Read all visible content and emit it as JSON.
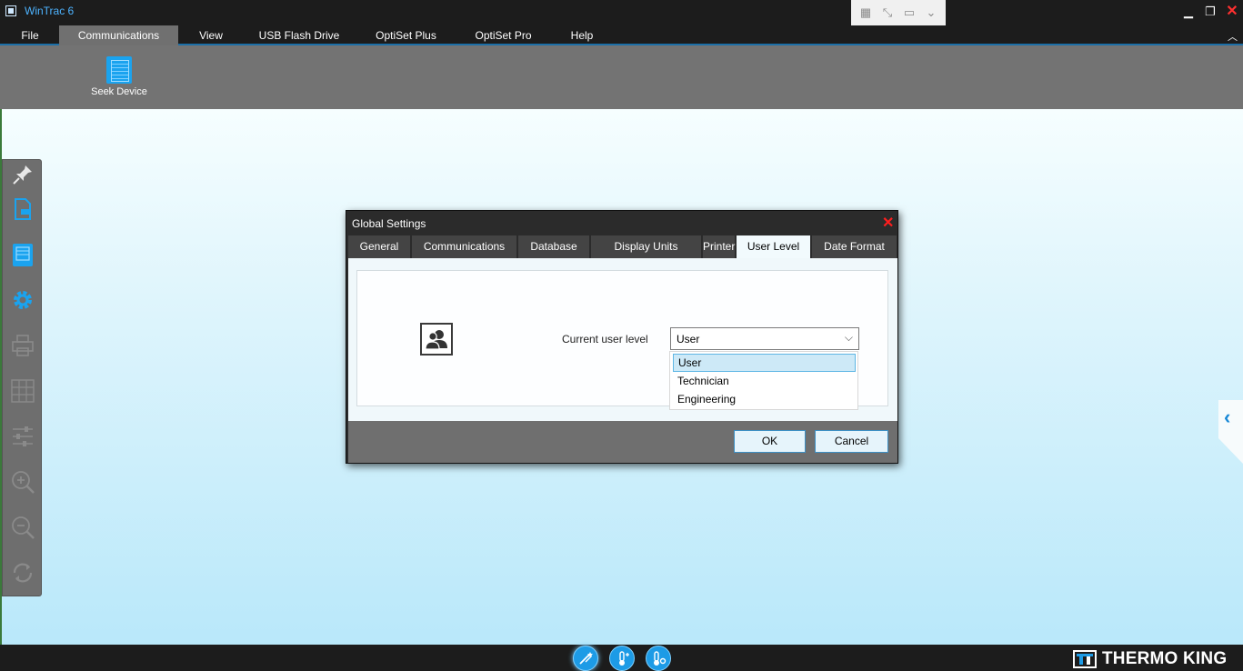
{
  "window": {
    "title": "WinTrac 6"
  },
  "menu": {
    "items": [
      {
        "label": "File"
      },
      {
        "label": "Communications"
      },
      {
        "label": "View"
      },
      {
        "label": "USB Flash Drive"
      },
      {
        "label": "OptiSet Plus"
      },
      {
        "label": "OptiSet Pro"
      },
      {
        "label": "Help"
      }
    ],
    "active": "Communications"
  },
  "ribbon": {
    "seek_device_label": "Seek Device"
  },
  "dialog": {
    "title": "Global Settings",
    "tabs": [
      {
        "label": "General"
      },
      {
        "label": "Communications"
      },
      {
        "label": "Database"
      },
      {
        "label": "Display Units"
      },
      {
        "label": "Printer"
      },
      {
        "label": "User Level"
      },
      {
        "label": "Date Format"
      }
    ],
    "active_tab": "User Level",
    "user_level": {
      "label": "Current user level",
      "selected": "User",
      "options": [
        "User",
        "Technician",
        "Engineering"
      ]
    },
    "ok_label": "OK",
    "cancel_label": "Cancel"
  },
  "brand": {
    "text": "THERMO KING"
  },
  "colors": {
    "accent": "#1aa3ef",
    "close_red": "#ff1e1e",
    "title_blue": "#4db3ff"
  }
}
